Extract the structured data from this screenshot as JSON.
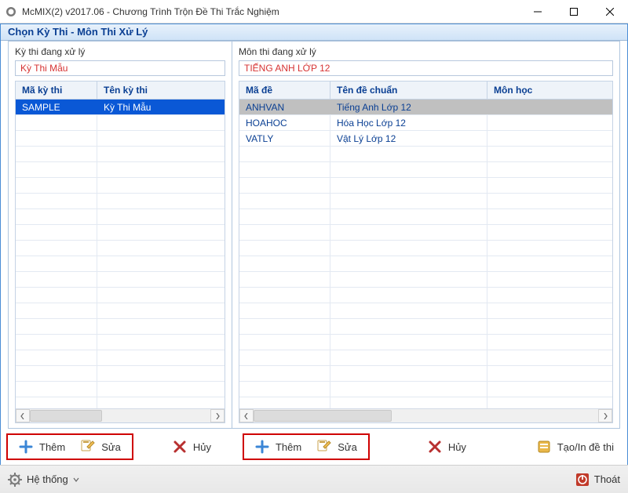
{
  "titlebar": {
    "text": "McMIX(2) v2017.06 - Chương Trình Trộn Đề Thi Trắc Nghiệm"
  },
  "subtitle": "Chọn Kỳ Thi - Môn Thi Xử Lý",
  "panes": {
    "left": {
      "head_label": "Kỳ thi đang xử lý",
      "head_value": "Kỳ Thi Mẫu",
      "columns": [
        "Mã kỳ thi",
        "Tên kỳ thi"
      ],
      "rows": [
        {
          "ma": "SAMPLE",
          "ten": "Kỳ Thi Mẫu",
          "selected": "blue"
        }
      ]
    },
    "right": {
      "head_label": "Môn thi đang xử lý",
      "head_value": "TIẾNG ANH LỚP 12",
      "columns": [
        "Mã đề",
        "Tên đề chuẩn",
        "Môn học"
      ],
      "rows": [
        {
          "ma": "ANHVAN",
          "ten": "Tiếng Anh Lớp 12",
          "mon": "",
          "selected": "grey"
        },
        {
          "ma": "HOAHOC",
          "ten": "Hóa Học Lớp 12",
          "mon": "",
          "selected": ""
        },
        {
          "ma": "VATLY",
          "ten": "Vật Lý Lớp 12",
          "mon": "",
          "selected": ""
        }
      ]
    }
  },
  "toolbar": {
    "them": "Thêm",
    "sua": "Sửa",
    "huy": "Hủy",
    "tao_in": "Tạo/In đề thi"
  },
  "statusbar": {
    "he_thong": "Hệ thống",
    "thoat": "Thoát"
  }
}
